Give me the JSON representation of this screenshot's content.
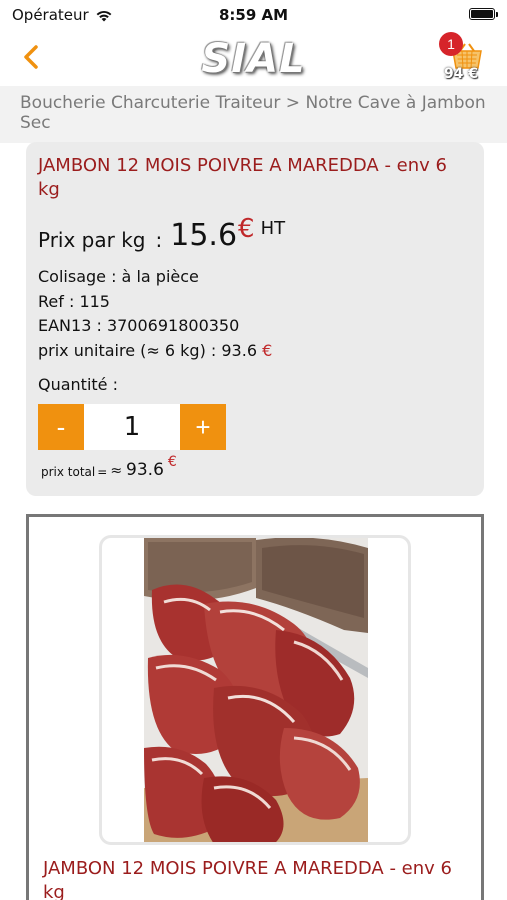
{
  "status_bar": {
    "carrier": "Opérateur",
    "time": "8:59 AM",
    "battery_level": 1.0
  },
  "header": {
    "logo_text": "SIAL",
    "cart_count": "1",
    "cart_total": "94 €",
    "icons": {
      "back": "chevron-left-icon",
      "cart": "shopping-basket-icon"
    },
    "colors": {
      "accent": "#f0910f",
      "badge": "#d6242a"
    }
  },
  "breadcrumb": {
    "text": "Boucherie Charcuterie Traiteur  > Notre Cave à Jambon Sec"
  },
  "product": {
    "title": "JAMBON 12 MOIS POIVRE A MAREDDA - env 6 kg",
    "price_label": "Prix par kg",
    "price_separator": ":",
    "price_value": "15.6",
    "price_currency": "€",
    "price_suffix": "HT",
    "colisage": "Colisage : à la pièce",
    "ref": "Ref : 115",
    "ean": "EAN13 : 3700691800350",
    "unit_price_label": "prix unitaire (≈ 6 kg) : 93.6",
    "unit_price_currency": "€",
    "quantity_label": "Quantité :",
    "decrement_label": "-",
    "quantity_value": "1",
    "increment_label": "+",
    "total_label": "prix total",
    "total_equals": "=",
    "total_approx": "≈",
    "total_value": "93.6",
    "total_currency": "€",
    "colors": {
      "title": "#9b1d1d",
      "currency": "#c0282a"
    }
  },
  "gallery": {
    "image_name": "prosciutto-ham-photo",
    "caption": "JAMBON 12 MOIS POIVRE A MAREDDA - env 6 kg"
  }
}
